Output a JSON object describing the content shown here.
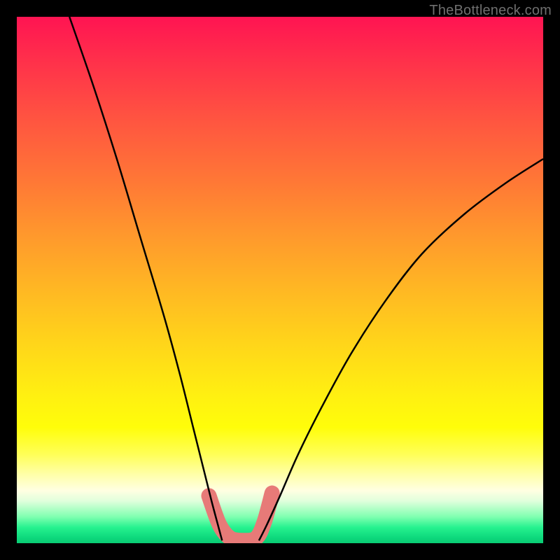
{
  "watermark": "TheBottleneck.com",
  "colors": {
    "page_bg": "#000000",
    "marker": "#e77a78",
    "curve": "#000000",
    "gradient_top": "#ff1452",
    "gradient_bottom": "#0acb73"
  },
  "chart_data": {
    "type": "line",
    "title": "",
    "xlabel": "",
    "ylabel": "",
    "xlim": [
      0,
      100
    ],
    "ylim": [
      0,
      100
    ],
    "note": "Axes are unlabeled in the source image; x/y values are normalized 0–100 estimated from pixel positions. y=0 is the bottom (green band), y=100 is the top (red band).",
    "series": [
      {
        "name": "left-curve",
        "x": [
          10.0,
          14.5,
          19.0,
          23.5,
          28.0,
          31.0,
          33.5,
          35.5,
          37.0,
          38.2,
          39.0
        ],
        "y": [
          100.0,
          87.0,
          73.0,
          58.0,
          43.0,
          32.0,
          22.0,
          14.0,
          8.0,
          3.5,
          0.5
        ]
      },
      {
        "name": "right-curve",
        "x": [
          46.0,
          47.5,
          50.0,
          53.5,
          58.0,
          63.5,
          70.0,
          77.0,
          85.0,
          93.0,
          100.0
        ],
        "y": [
          0.5,
          3.5,
          9.0,
          17.0,
          26.0,
          36.0,
          46.0,
          55.0,
          62.5,
          68.5,
          73.0
        ]
      },
      {
        "name": "highlight-marker",
        "x": [
          36.5,
          38.5,
          40.5,
          43.0,
          45.5,
          47.0,
          48.5
        ],
        "y": [
          9.0,
          3.5,
          1.0,
          0.5,
          1.0,
          4.0,
          9.5
        ]
      }
    ]
  }
}
